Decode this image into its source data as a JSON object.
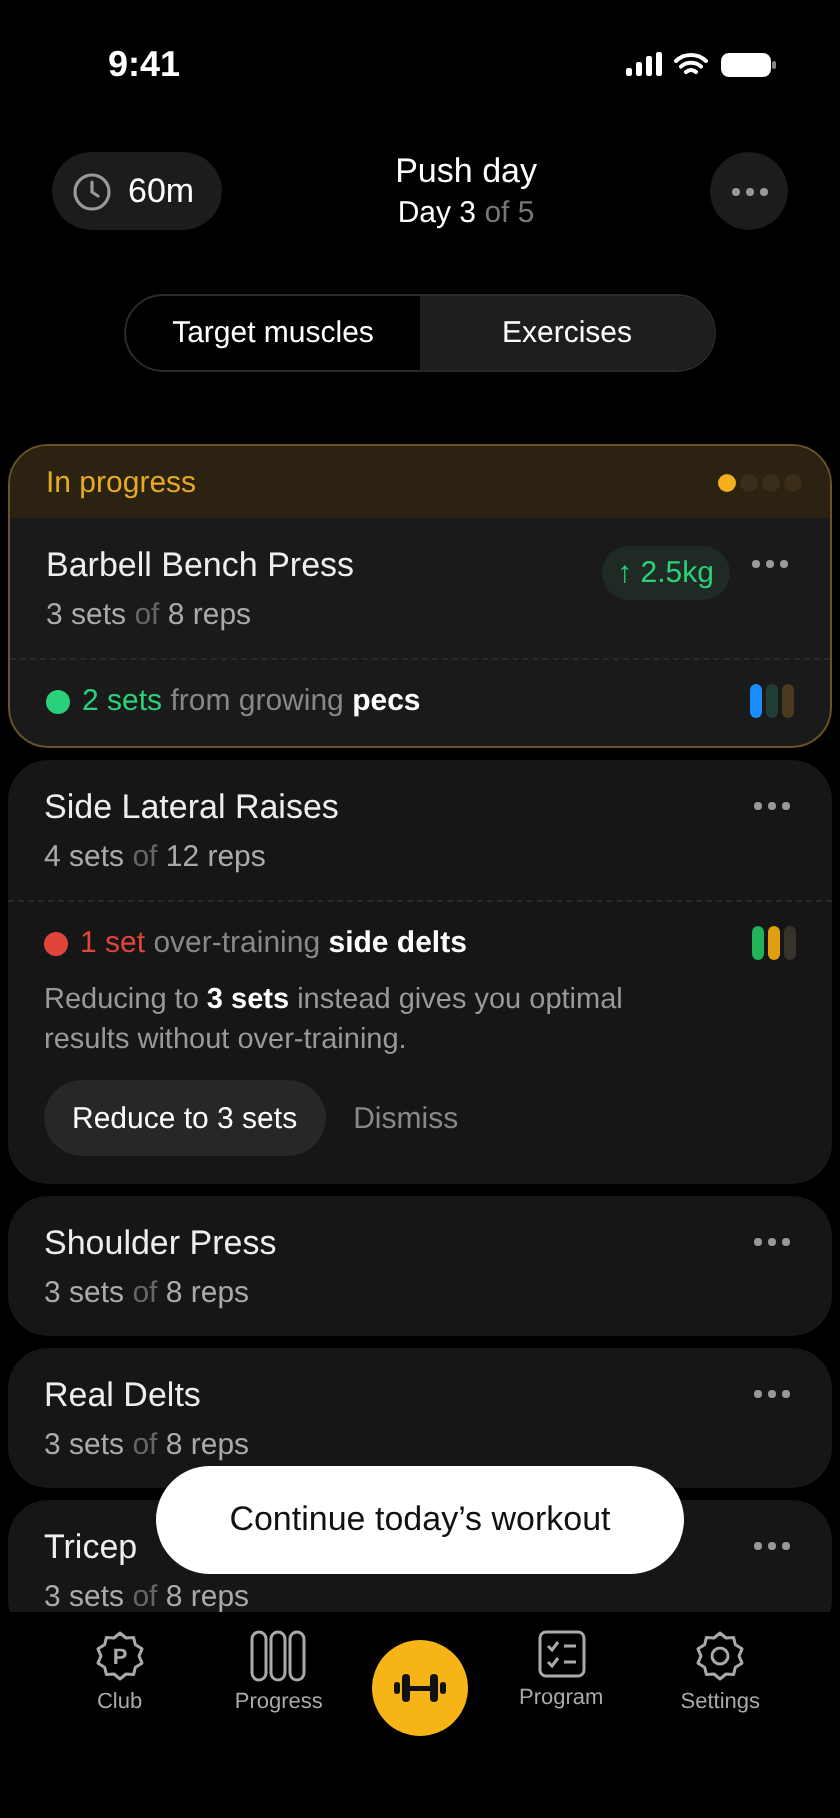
{
  "status_bar": {
    "time": "9:41"
  },
  "header": {
    "duration": "60m",
    "title": "Push day",
    "day": "Day 3",
    "day_total": "of 5"
  },
  "tabs": [
    {
      "label": "Target muscles",
      "selected": false
    },
    {
      "label": "Exercises",
      "selected": true
    }
  ],
  "exercises": [
    {
      "status": {
        "label": "In progress",
        "dots": [
          {
            "selected": true
          },
          {
            "selected": false
          },
          {
            "selected": false
          },
          {
            "selected": false
          }
        ]
      },
      "title": "Barbell Bench Press",
      "sets": "3 sets",
      "of": "of",
      "reps": "8 reps",
      "badge": "↑ 2.5kg",
      "insight": {
        "color": "#2bd07a",
        "count": "2 sets",
        "text": "from growing",
        "muscle": "pecs",
        "bars": [
          {
            "color": "#1a8cff"
          },
          {
            "color": "#1f3f36"
          },
          {
            "color": "#4a3a20"
          }
        ]
      }
    },
    {
      "title": "Side Lateral Raises",
      "sets": "4 sets",
      "of": "of",
      "reps": "12 reps",
      "insight": {
        "color": "#e0443a",
        "count": "1 set",
        "text": "over-training",
        "muscle": "side delts",
        "bars": [
          {
            "color": "#22b35a"
          },
          {
            "color": "#e0a010"
          },
          {
            "color": "#36342a"
          }
        ],
        "note": "Reducing to **3 sets** instead gives you optimal results without over-training.",
        "actions": [
          "Reduce to 3 sets",
          "Dismiss"
        ]
      }
    },
    {
      "title": "Shoulder Press",
      "sets": "3 sets",
      "of": "of",
      "reps": "8 reps"
    },
    {
      "title": "Real Delts",
      "sets": "3 sets",
      "of": "of",
      "reps": "8 reps"
    },
    {
      "title": "Tricep",
      "sets": "3 sets",
      "of": "of",
      "reps": "8 reps"
    }
  ],
  "toast": "Continue today’s workout",
  "nav": [
    {
      "kind": "club",
      "label": "Club",
      "icon_letter": "P"
    },
    {
      "kind": "progress",
      "label": "Progress"
    },
    {
      "kind": "workout"
    },
    {
      "kind": "program",
      "label": "Program"
    },
    {
      "kind": "settings",
      "label": "Settings"
    }
  ]
}
